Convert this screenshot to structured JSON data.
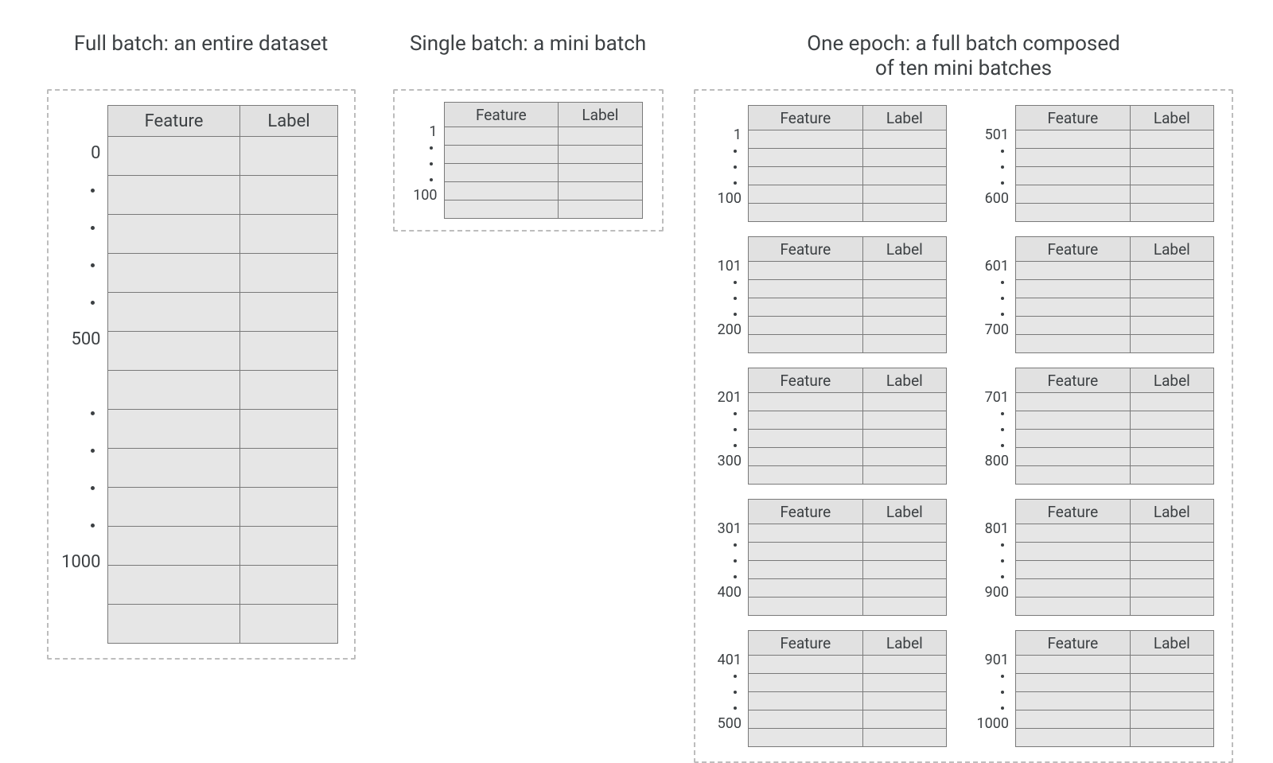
{
  "headers": {
    "feature": "Feature",
    "label": "Label"
  },
  "panels": {
    "full": {
      "title": "Full batch: an entire dataset",
      "index_first": "0",
      "index_mid": "500",
      "index_last": "1000"
    },
    "single": {
      "title": "Single batch: a mini batch",
      "index_first": "1",
      "index_last": "100"
    },
    "epoch": {
      "title_line1": "One epoch: a full batch composed",
      "title_line2": "of ten mini batches",
      "minis": [
        {
          "first": "1",
          "last": "100"
        },
        {
          "first": "501",
          "last": "600"
        },
        {
          "first": "101",
          "last": "200"
        },
        {
          "first": "601",
          "last": "700"
        },
        {
          "first": "201",
          "last": "300"
        },
        {
          "first": "701",
          "last": "800"
        },
        {
          "first": "301",
          "last": "400"
        },
        {
          "first": "801",
          "last": "900"
        },
        {
          "first": "401",
          "last": "500"
        },
        {
          "first": "901",
          "last": "1000"
        }
      ]
    }
  }
}
